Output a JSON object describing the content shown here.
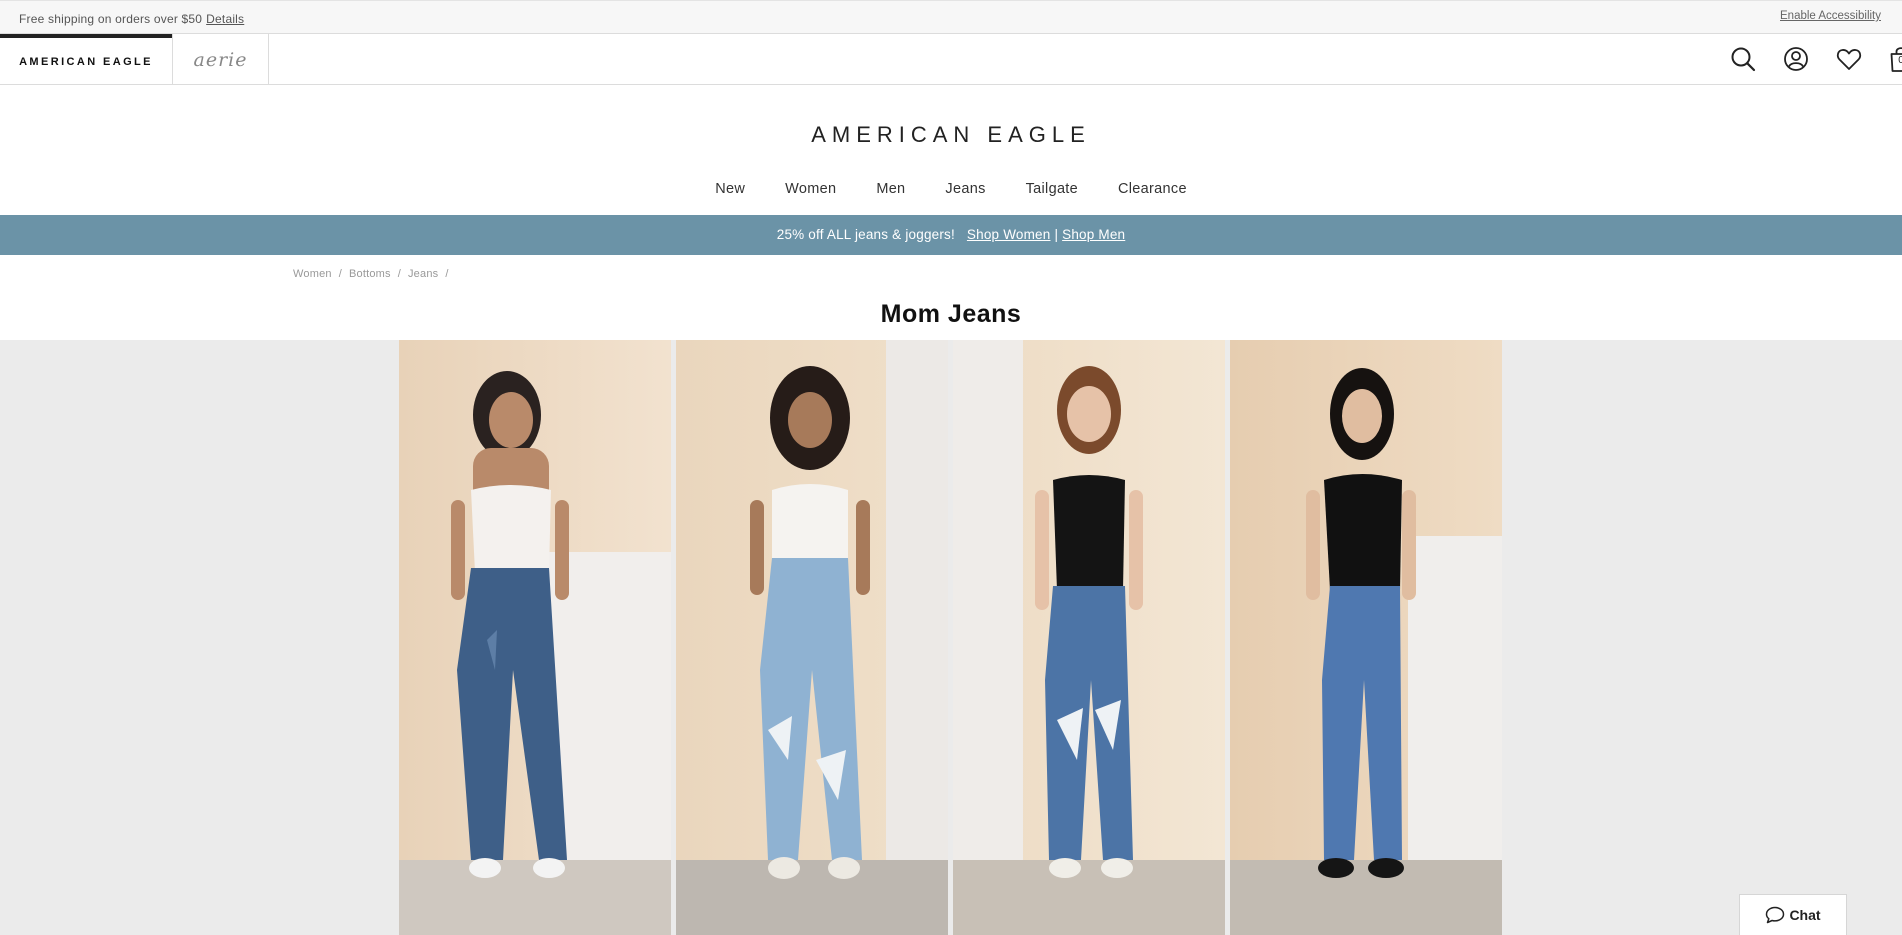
{
  "utility": {
    "shipping_text": "Free shipping on orders over $50",
    "details_link": "Details",
    "accessibility_link": "Enable Accessibility"
  },
  "brands": {
    "ae_label": "AMERICAN EAGLE",
    "aerie_label": "aerie"
  },
  "header": {
    "bag_count": "0",
    "icons": [
      "search-icon",
      "account-icon",
      "heart-icon",
      "bag-icon"
    ]
  },
  "logo": "AMERICAN EAGLE",
  "nav": [
    "New",
    "Women",
    "Men",
    "Jeans",
    "Tailgate",
    "Clearance"
  ],
  "banner": {
    "text": "25% off ALL jeans & joggers!",
    "link_women": "Shop Women",
    "separator": "|",
    "link_men": "Shop Men",
    "color": "#6b93a7"
  },
  "breadcrumb": [
    "Women",
    "Bottoms",
    "Jeans"
  ],
  "page_title": "Mom Jeans",
  "gallery": {
    "images": [
      "model-1-white-cami-dark-wash",
      "model-2-white-tee-light-ripped",
      "model-3-black-tank-ripped",
      "model-4-black-tee-medium-wash"
    ]
  },
  "chat": {
    "label": "Chat"
  }
}
